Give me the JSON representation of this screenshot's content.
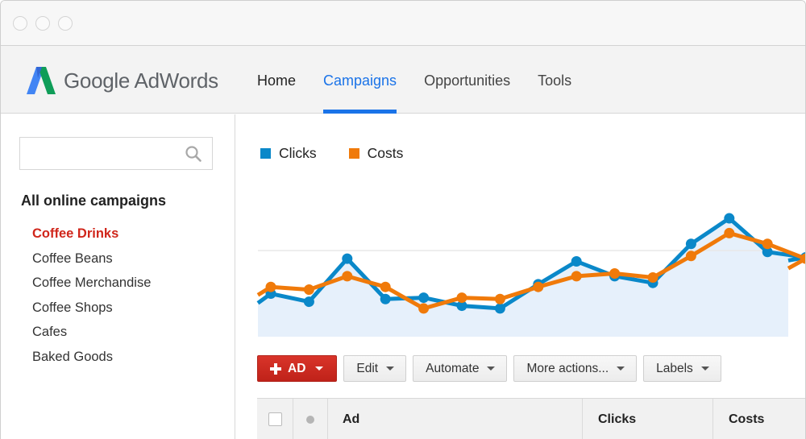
{
  "window": {
    "traffic_lights": [
      "close",
      "minimize",
      "maximize"
    ]
  },
  "header": {
    "logo_text": "Google AdWords",
    "logo_colors": {
      "blue": "#4285f4",
      "green": "#0f9d58",
      "yellow": "#f4b400"
    },
    "nav": [
      {
        "label": "Home",
        "active": false
      },
      {
        "label": "Campaigns",
        "active": true
      },
      {
        "label": "Opportunities",
        "active": false
      },
      {
        "label": "Tools",
        "active": false
      }
    ],
    "accent_color": "#1a73e8"
  },
  "sidebar": {
    "search": {
      "value": "",
      "placeholder": "",
      "icon": "search-icon"
    },
    "heading": "All online campaigns",
    "campaigns": [
      {
        "label": "Coffee Drinks",
        "active": true
      },
      {
        "label": "Coffee Beans",
        "active": false
      },
      {
        "label": "Coffee Merchandise",
        "active": false
      },
      {
        "label": "Coffee Shops",
        "active": false
      },
      {
        "label": "Cafes",
        "active": false
      },
      {
        "label": "Baked Goods",
        "active": false
      }
    ],
    "active_color": "#d0261b"
  },
  "chart_data": {
    "type": "line",
    "title": "",
    "xlabel": "",
    "ylabel": "",
    "ylim": [
      0,
      100
    ],
    "grid": true,
    "gridlines": [
      64
    ],
    "legend": "top-left",
    "area_fill_series": "Clicks",
    "x": [
      0,
      1,
      2,
      3,
      4,
      5,
      6,
      7,
      8,
      9,
      10,
      11,
      12,
      13,
      14
    ],
    "series": [
      {
        "name": "Clicks",
        "color": "#0a88c9",
        "values": [
          32,
          26,
          58,
          28,
          29,
          23,
          21,
          39,
          56,
          45,
          40,
          69,
          88,
          63,
          59
        ]
      },
      {
        "name": "Costs",
        "color": "#f07a0a",
        "values": [
          37,
          35,
          45,
          37,
          21,
          29,
          28,
          37,
          45,
          47,
          44,
          60,
          77,
          69,
          58
        ]
      }
    ],
    "start_values": {
      "Clicks": 25,
      "Costs": 31
    }
  },
  "toolbar": {
    "add_ad_label": "AD",
    "edit_label": "Edit",
    "automate_label": "Automate",
    "more_actions_label": "More actions...",
    "labels_label": "Labels"
  },
  "table": {
    "columns": [
      "",
      "",
      "Ad",
      "Clicks",
      "Costs"
    ]
  }
}
